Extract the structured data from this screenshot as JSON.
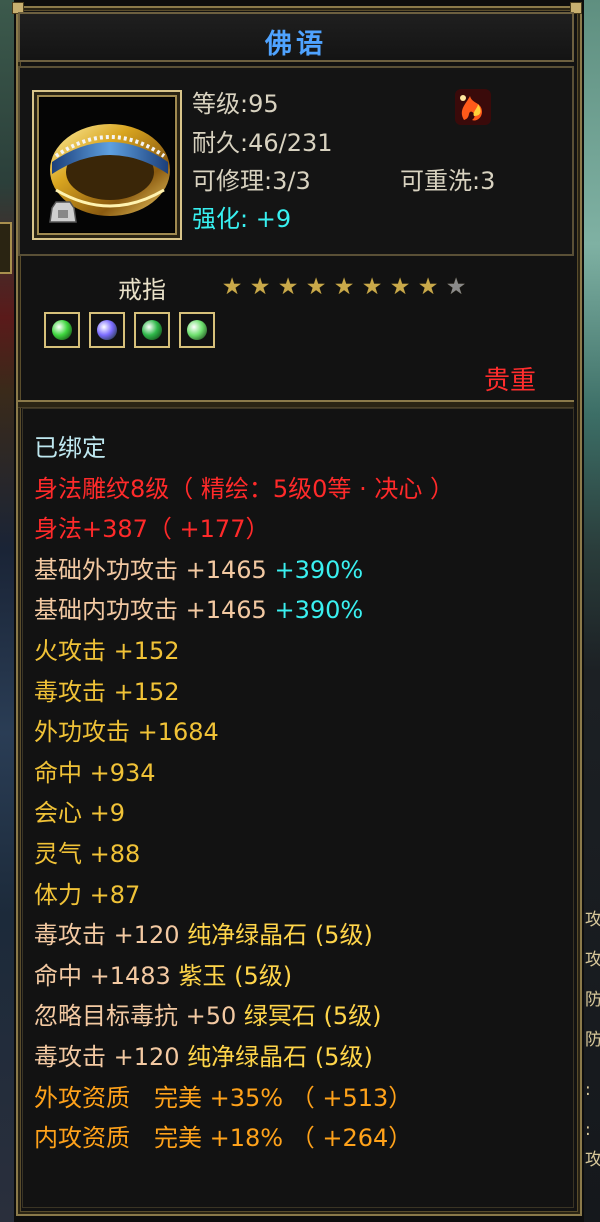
{
  "item": {
    "title": "佛语",
    "stats": {
      "level": "等级:95",
      "durability": "耐久:46/231",
      "repairable": "可修理:3/3",
      "rewashable": "可重洗:3",
      "enhance": "强化: +9"
    },
    "type_label": "戒指",
    "stars": {
      "filled": 8,
      "total": 9,
      "icon": "star-icon"
    },
    "gems": [
      {
        "icon": "green-gem-icon",
        "color": "#3fd63f"
      },
      {
        "icon": "purple-gem-icon",
        "color": "#7b6cff"
      },
      {
        "icon": "green-leaf-gem-icon",
        "color": "#2fb84a"
      },
      {
        "icon": "green-gem-icon",
        "color": "#6ee06e"
      }
    ],
    "rarity": "贵重",
    "ring_icon": "gold-ring-icon",
    "badge_icon": "flame-badge-icon"
  },
  "attributes": [
    {
      "parts": [
        {
          "text": "已绑定",
          "color": "white"
        }
      ]
    },
    {
      "parts": [
        {
          "text": "身法雕纹8级（ 精绘：5级0等 · 决心 ）",
          "color": "red"
        }
      ]
    },
    {
      "parts": [
        {
          "text": "身法+387（ +177）",
          "color": "red"
        }
      ]
    },
    {
      "parts": [
        {
          "text": "基础外功攻击 +1465 ",
          "color": "peach"
        },
        {
          "text": "+390%",
          "color": "cyan"
        }
      ]
    },
    {
      "parts": [
        {
          "text": "基础内功攻击 +1465 ",
          "color": "peach"
        },
        {
          "text": "+390%",
          "color": "cyan"
        }
      ]
    },
    {
      "parts": [
        {
          "text": "火攻击 +152",
          "color": "yellow"
        }
      ]
    },
    {
      "parts": [
        {
          "text": "毒攻击 +152",
          "color": "yellow"
        }
      ]
    },
    {
      "parts": [
        {
          "text": "外功攻击 +1684",
          "color": "yellow"
        }
      ]
    },
    {
      "parts": [
        {
          "text": "命中 +934",
          "color": "yellow"
        }
      ]
    },
    {
      "parts": [
        {
          "text": "会心 +9",
          "color": "yellow"
        }
      ]
    },
    {
      "parts": [
        {
          "text": "灵气 +88",
          "color": "yellow"
        }
      ]
    },
    {
      "parts": [
        {
          "text": "体力 +87",
          "color": "yellow"
        }
      ]
    },
    {
      "parts": [
        {
          "text": "毒攻击 +120 ",
          "color": "peach"
        },
        {
          "text": "纯净绿晶石 (5级)",
          "color": "gem"
        }
      ]
    },
    {
      "parts": [
        {
          "text": "命中 +1483 ",
          "color": "peach"
        },
        {
          "text": "紫玉 (5级)",
          "color": "gem"
        }
      ]
    },
    {
      "parts": [
        {
          "text": "忽略目标毒抗 +50 ",
          "color": "peach"
        },
        {
          "text": "绿冥石 (5级)",
          "color": "gem"
        }
      ]
    },
    {
      "parts": [
        {
          "text": "毒攻击 +120 ",
          "color": "peach"
        },
        {
          "text": "纯净绿晶石 (5级)",
          "color": "gem"
        }
      ]
    },
    {
      "parts": [
        {
          "text": "外攻资质　完美 +35% （ +513）",
          "color": "orange"
        }
      ]
    },
    {
      "parts": [
        {
          "text": "内攻资质　完美 +18% （ +264）",
          "color": "orange"
        }
      ]
    }
  ],
  "background": {
    "right_edge_chars": [
      "攻",
      "攻",
      "防",
      "防",
      ":",
      ":",
      "攻"
    ]
  }
}
